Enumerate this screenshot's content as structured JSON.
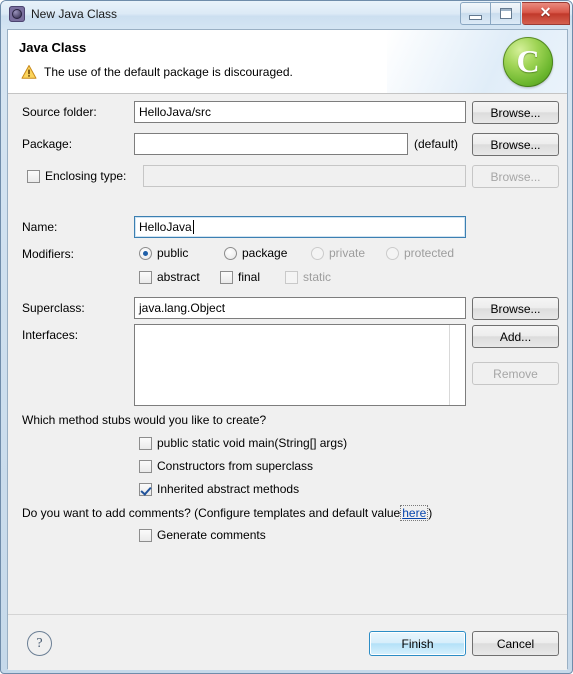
{
  "window": {
    "title": "New Java Class",
    "icon": "wizard-gear-icon",
    "buttons": {
      "minimize": "minimize-icon",
      "maximize": "maximize-icon",
      "close": "✕"
    }
  },
  "header": {
    "title": "Java Class",
    "message": "The use of the default package is discouraged.",
    "message_icon": "warning-triangle-icon",
    "banner_icon_letter": "C",
    "banner_icon_color": "#76c22e"
  },
  "form": {
    "source_folder": {
      "label": "Source folder:",
      "value": "HelloJava/src",
      "placeholder": "",
      "browse_label": "Browse..."
    },
    "package": {
      "label": "Package:",
      "value": "",
      "placeholder": "",
      "default_hint": "(default)",
      "browse_label": "Browse..."
    },
    "enclosing_type": {
      "label": "Enclosing type:",
      "checked": false,
      "value": "",
      "browse_label": "Browse...",
      "enabled": false
    },
    "name": {
      "label": "Name:",
      "value": "HelloJava",
      "placeholder": "",
      "focused": true
    },
    "modifiers": {
      "label": "Modifiers:",
      "radios": [
        {
          "label": "public",
          "checked": true,
          "enabled": true
        },
        {
          "label": "package",
          "checked": false,
          "enabled": true
        },
        {
          "label": "private",
          "checked": false,
          "enabled": false
        },
        {
          "label": "protected",
          "checked": false,
          "enabled": false
        }
      ],
      "checkboxes": [
        {
          "label": "abstract",
          "checked": false,
          "enabled": true
        },
        {
          "label": "final",
          "checked": false,
          "enabled": true
        },
        {
          "label": "static",
          "checked": false,
          "enabled": false
        }
      ]
    },
    "superclass": {
      "label": "Superclass:",
      "value": "java.lang.Object",
      "browse_label": "Browse..."
    },
    "interfaces": {
      "label": "Interfaces:",
      "items": [],
      "add_label": "Add...",
      "remove_label": "Remove",
      "remove_enabled": false
    }
  },
  "stubs": {
    "question": "Which method stubs would you like to create?",
    "options": [
      {
        "label": "public static void main(String[] args)",
        "checked": false
      },
      {
        "label": "Constructors from superclass",
        "checked": false
      },
      {
        "label": "Inherited abstract methods",
        "checked": true
      }
    ]
  },
  "comments": {
    "question_prefix": "Do you want to add comments? (Configure templates and default value ",
    "link_text": "here",
    "question_suffix": ")",
    "option": {
      "label": "Generate comments",
      "checked": false
    }
  },
  "footer": {
    "help_label": "?",
    "finish_label": "Finish",
    "cancel_label": "Cancel"
  }
}
